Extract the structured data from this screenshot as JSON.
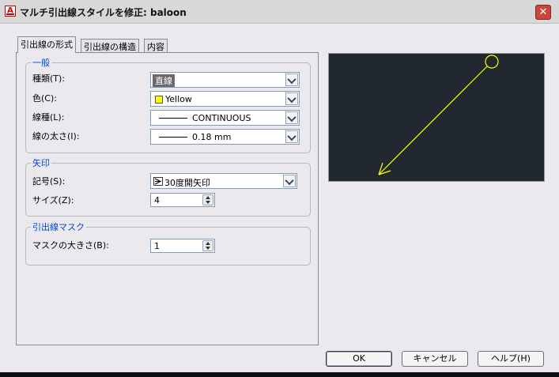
{
  "window": {
    "title": "マルチ引出線スタイルを修正: baloon",
    "icon_letter": "A"
  },
  "tabs": [
    {
      "label": "引出線の形式",
      "active": true
    },
    {
      "label": "引出線の構造",
      "active": false
    },
    {
      "label": "内容",
      "active": false
    }
  ],
  "general": {
    "legend": "一般",
    "type_label": "種類(T):",
    "type_value": "直線",
    "color_label": "色(C):",
    "color_value": "Yellow",
    "color_hex": "#ffff00",
    "linetype_label": "線種(L):",
    "linetype_value": "CONTINUOUS",
    "lineweight_label": "線の太さ(I):",
    "lineweight_value": "0.18 mm"
  },
  "arrowhead": {
    "legend": "矢印",
    "symbol_label": "記号(S):",
    "symbol_value": "30度開矢印",
    "size_label": "サイズ(Z):",
    "size_value": "4"
  },
  "leader_break": {
    "legend": "引出線マスク",
    "break_size_label": "マスクの大きさ(B):",
    "break_size_value": "1"
  },
  "buttons": {
    "ok": "OK",
    "cancel": "キャンセル",
    "help": "ヘルプ(H)"
  }
}
